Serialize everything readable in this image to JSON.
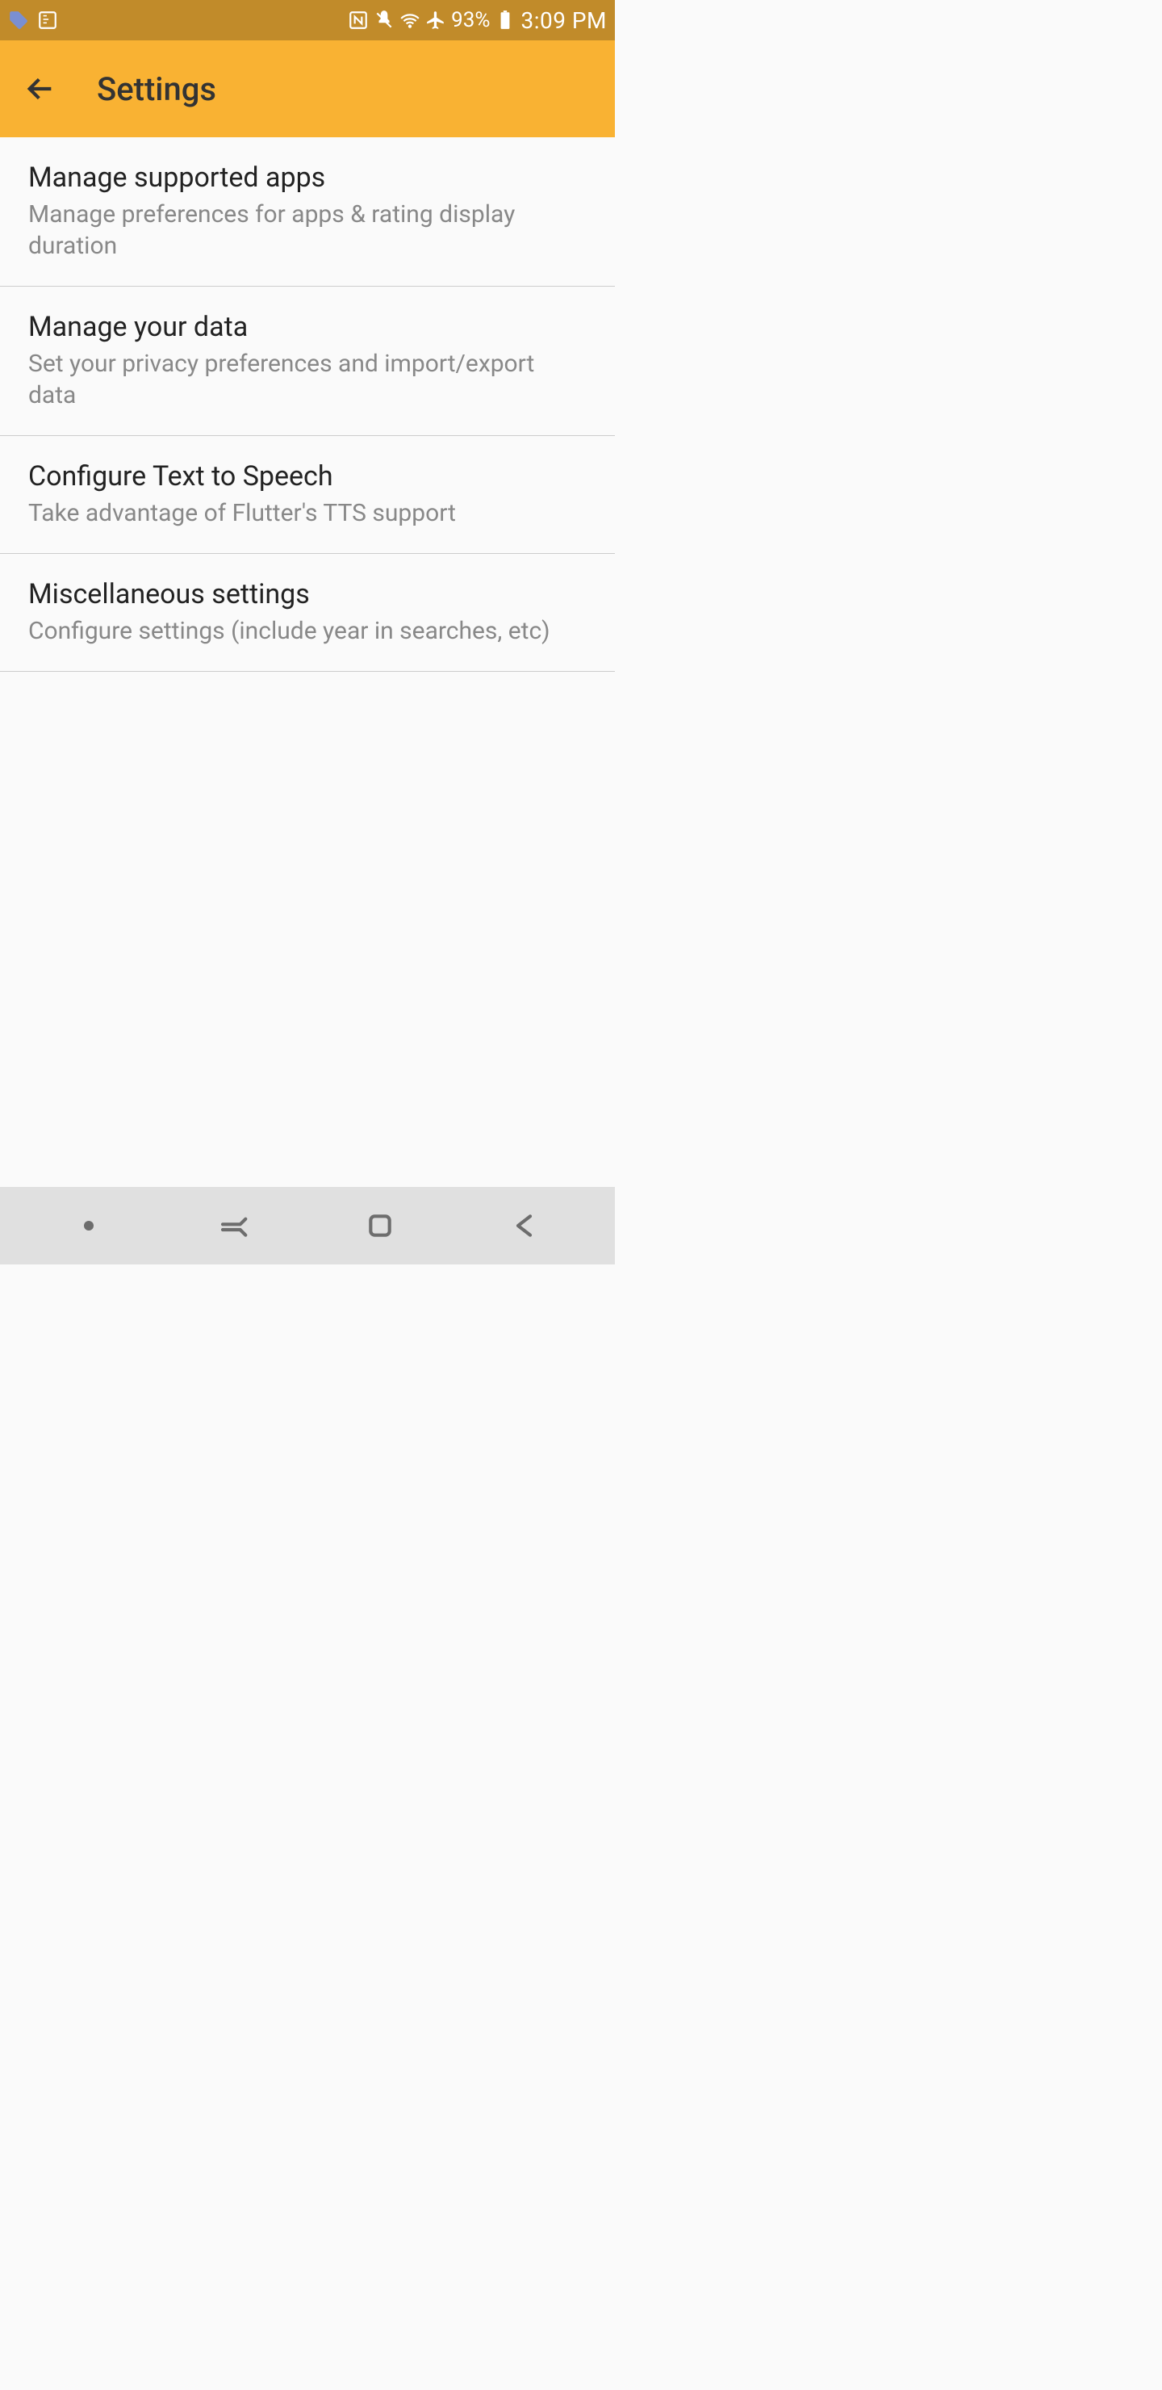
{
  "status": {
    "battery_pct": "93%",
    "time": "3:09 PM"
  },
  "header": {
    "title": "Settings"
  },
  "items": [
    {
      "title": "Manage supported apps",
      "subtitle": "Manage preferences for apps & rating display duration"
    },
    {
      "title": "Manage your data",
      "subtitle": "Set your privacy preferences and import/export data"
    },
    {
      "title": "Configure Text to Speech",
      "subtitle": "Take advantage of Flutter's TTS support"
    },
    {
      "title": "Miscellaneous settings",
      "subtitle": "Configure settings (include year in searches, etc)"
    }
  ]
}
